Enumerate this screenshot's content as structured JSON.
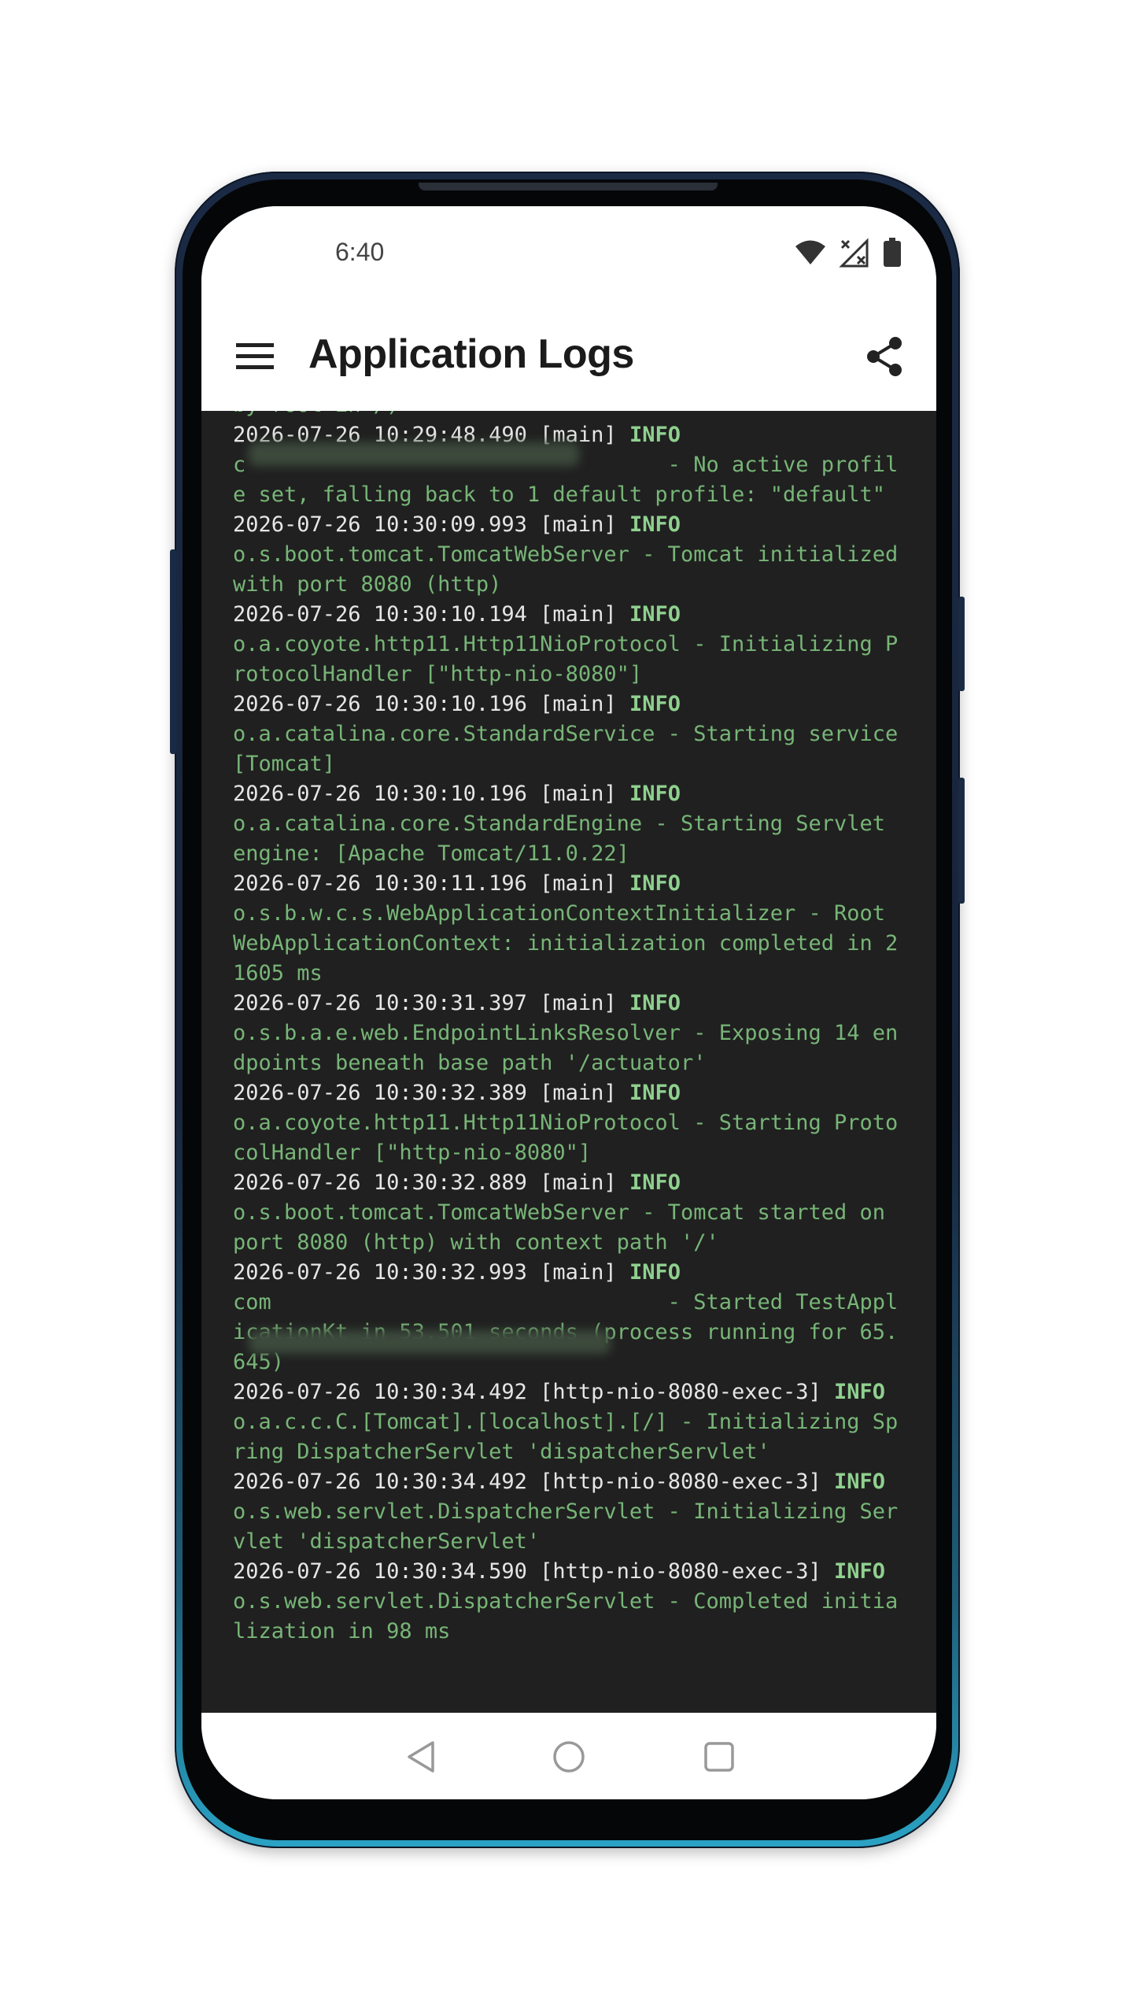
{
  "status_bar": {
    "time": "6:40",
    "icons": [
      "wifi-icon",
      "no-signal-icon",
      "battery-icon"
    ]
  },
  "app_bar": {
    "title": "Application Logs",
    "menu_icon": "hamburger-menu-icon",
    "share_icon": "share-icon"
  },
  "logs": {
    "top_fragment": "by root in /)",
    "entries": [
      {
        "timestamp": "2026-07-26 10:29:48.490",
        "thread": "[main]",
        "level": "INFO",
        "message": "c                                 - No active profile set, falling back to 1 default profile: \"default\""
      },
      {
        "timestamp": "2026-07-26 10:30:09.993",
        "thread": "[main]",
        "level": "INFO",
        "message": "o.s.boot.tomcat.TomcatWebServer - Tomcat initialized with port 8080 (http)"
      },
      {
        "timestamp": "2026-07-26 10:30:10.194",
        "thread": "[main]",
        "level": "INFO",
        "message": "o.a.coyote.http11.Http11NioProtocol - Initializing ProtocolHandler [\"http-nio-8080\"]"
      },
      {
        "timestamp": "2026-07-26 10:30:10.196",
        "thread": "[main]",
        "level": "INFO",
        "message": "o.a.catalina.core.StandardService - Starting service [Tomcat]"
      },
      {
        "timestamp": "2026-07-26 10:30:10.196",
        "thread": "[main]",
        "level": "INFO",
        "message": "o.a.catalina.core.StandardEngine - Starting Servlet engine: [Apache Tomcat/11.0.22]"
      },
      {
        "timestamp": "2026-07-26 10:30:11.196",
        "thread": "[main]",
        "level": "INFO",
        "message": "o.s.b.w.c.s.WebApplicationContextInitializer - Root WebApplicationContext: initialization completed in 21605 ms"
      },
      {
        "timestamp": "2026-07-26 10:30:31.397",
        "thread": "[main]",
        "level": "INFO",
        "message": "o.s.b.a.e.web.EndpointLinksResolver - Exposing 14 endpoints beneath base path '/actuator'"
      },
      {
        "timestamp": "2026-07-26 10:30:32.389",
        "thread": "[main]",
        "level": "INFO",
        "message": "o.a.coyote.http11.Http11NioProtocol - Starting ProtocolHandler [\"http-nio-8080\"]"
      },
      {
        "timestamp": "2026-07-26 10:30:32.889",
        "thread": "[main]",
        "level": "INFO",
        "message": "o.s.boot.tomcat.TomcatWebServer - Tomcat started on port 8080 (http) with context path '/'"
      },
      {
        "timestamp": "2026-07-26 10:30:32.993",
        "thread": "[main]",
        "level": "INFO",
        "message": "com                               - Started TestApplicationKt in 53.501 seconds (process running for 65.645)"
      },
      {
        "timestamp": "2026-07-26 10:30:34.492",
        "thread": "[http-nio-8080-exec-3]",
        "level": "INFO",
        "message": "o.a.c.c.C.[Tomcat].[localhost].[/] - Initializing Spring DispatcherServlet 'dispatcherServlet'"
      },
      {
        "timestamp": "2026-07-26 10:30:34.492",
        "thread": "[http-nio-8080-exec-3]",
        "level": "INFO",
        "message": "o.s.web.servlet.DispatcherServlet - Initializing Servlet 'dispatcherServlet'"
      },
      {
        "timestamp": "2026-07-26 10:30:34.590",
        "thread": "[http-nio-8080-exec-3]",
        "level": "INFO",
        "message": "o.s.web.servlet.DispatcherServlet - Completed initialization in 98 ms"
      }
    ]
  },
  "nav_bar": {
    "icons": [
      "back-icon",
      "home-icon",
      "recents-icon"
    ]
  },
  "colors": {
    "log_background": "#202020",
    "log_header": "#e6e6e6",
    "log_level": "#8fd08f",
    "log_message": "#77b577"
  }
}
